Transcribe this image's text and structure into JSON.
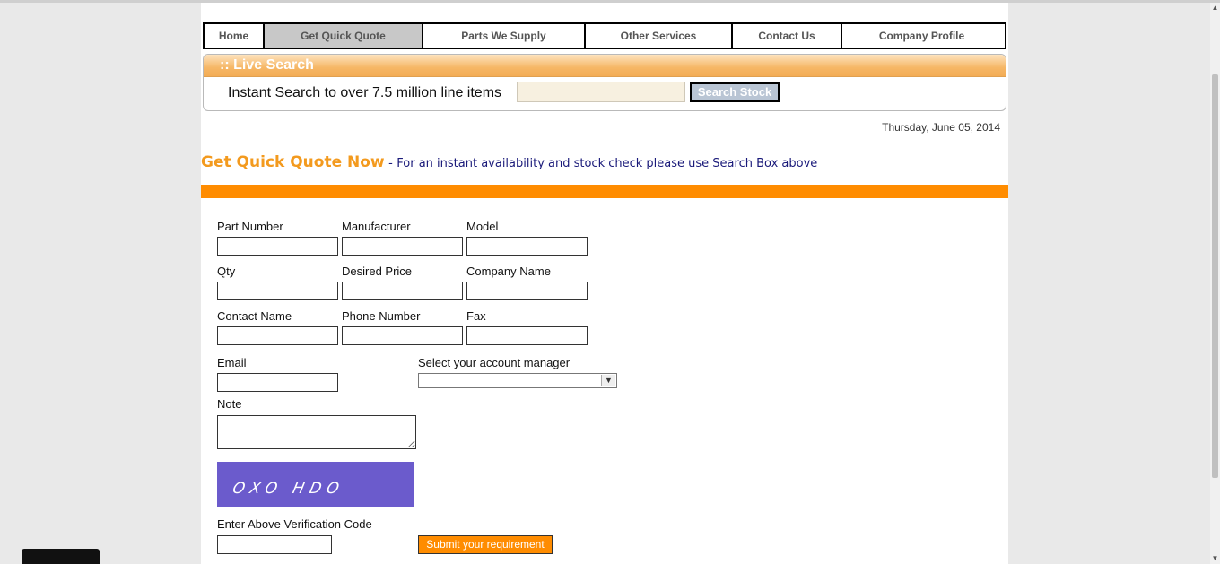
{
  "nav": {
    "items": [
      {
        "label": "Home"
      },
      {
        "label": "Get Quick Quote"
      },
      {
        "label": "Parts We Supply"
      },
      {
        "label": "Other Services"
      },
      {
        "label": "Contact Us"
      },
      {
        "label": "Company Profile"
      }
    ],
    "active_index": 1
  },
  "live_search": {
    "title": ":: Live Search",
    "prompt": "Instant Search to over 7.5 million line items",
    "input_value": "",
    "button_label": "Search Stock"
  },
  "date": "Thursday, June 05, 2014",
  "quote": {
    "title": "Get Quick Quote Now",
    "separator": "-",
    "subtitle": "For an instant availability and stock check please use Search Box above"
  },
  "form": {
    "part_number": "Part Number",
    "manufacturer": "Manufacturer",
    "model": "Model",
    "qty": "Qty",
    "desired_price": "Desired Price",
    "company_name": "Company Name",
    "contact_name": "Contact Name",
    "phone_number": "Phone Number",
    "fax": "Fax",
    "email": "Email",
    "account_manager": "Select your account manager",
    "account_manager_value": "",
    "note": "Note",
    "captcha_text": "OXO HDO",
    "verify_label": "Enter Above Verification Code",
    "submit_label": "Submit your requirement"
  },
  "colors": {
    "accent_orange": "#ff8c00",
    "title_orange": "#f39a1e",
    "subtitle_navy": "#1a1a7a",
    "captcha_bg": "#6b5bcc"
  }
}
